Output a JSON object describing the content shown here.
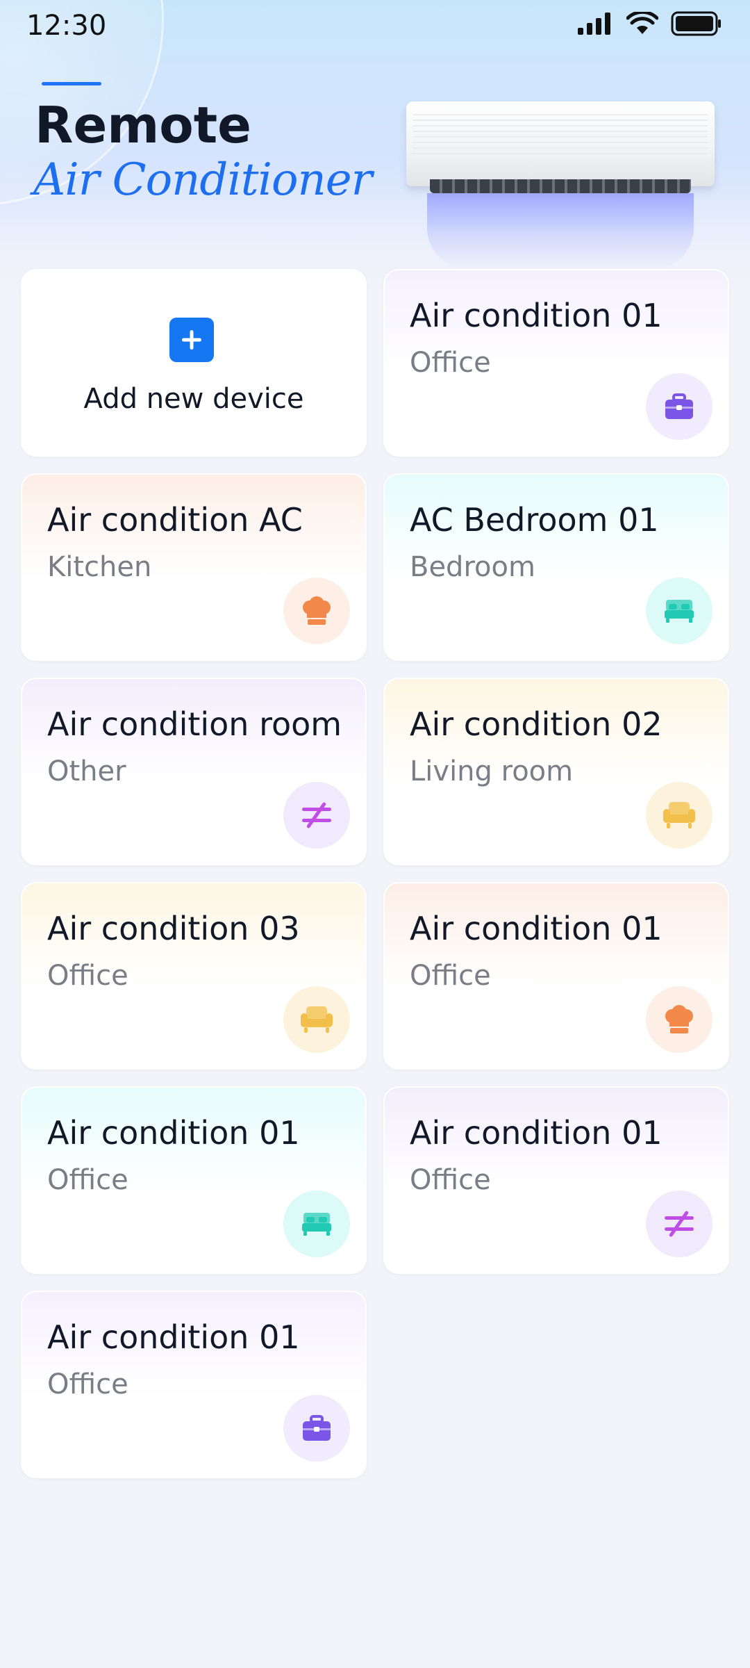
{
  "status": {
    "time": "12:30"
  },
  "header": {
    "title": "Remote",
    "subtitle": "Air Conditioner"
  },
  "add_card": {
    "label": "Add new device",
    "icon": "plus-icon"
  },
  "devices": [
    {
      "name": "Air condition 01",
      "room": "Office",
      "icon": "briefcase-icon",
      "icon_color": "#7b55e6",
      "bg": "#f1ecfd",
      "tint": "#f5f0ff"
    },
    {
      "name": "Air condition AC",
      "room": "Kitchen",
      "icon": "chef-hat-icon",
      "icon_color": "#f2884a",
      "bg": "#fdefe6",
      "tint": "#fdeee6"
    },
    {
      "name": "AC Bedroom 01",
      "room": "Bedroom",
      "icon": "bed-icon",
      "icon_color": "#22c9b3",
      "bg": "#dcfaf8",
      "tint": "#e6fcfc"
    },
    {
      "name": "Air condition room",
      "room": "Other",
      "icon": "not-equal-icon",
      "icon_color": "#c04ee6",
      "bg": "#f1e9fc",
      "tint": "#f3eefc"
    },
    {
      "name": "Air condition 02",
      "room": "Living room",
      "icon": "armchair-icon",
      "icon_color": "#f2c04a",
      "bg": "#fdf3dd",
      "tint": "#fdf6e3"
    },
    {
      "name": "Air condition 03",
      "room": "Office",
      "icon": "armchair-icon",
      "icon_color": "#f2c04a",
      "bg": "#fdf3dd",
      "tint": "#fdf6e3"
    },
    {
      "name": "Air condition 01",
      "room": "Office",
      "icon": "chef-hat-icon",
      "icon_color": "#f2884a",
      "bg": "#fdefe6",
      "tint": "#fdeee6"
    },
    {
      "name": "Air condition 01",
      "room": "Office",
      "icon": "bed-icon",
      "icon_color": "#22c9b3",
      "bg": "#dcfaf8",
      "tint": "#e6fcfc"
    },
    {
      "name": "Air condition 01",
      "room": "Office",
      "icon": "not-equal-icon",
      "icon_color": "#c04ee6",
      "bg": "#f1e9fc",
      "tint": "#f3eefc"
    },
    {
      "name": "Air condition 01",
      "room": "Office",
      "icon": "briefcase-icon",
      "icon_color": "#7b55e6",
      "bg": "#f1ecfd",
      "tint": "#f5f0ff"
    }
  ]
}
